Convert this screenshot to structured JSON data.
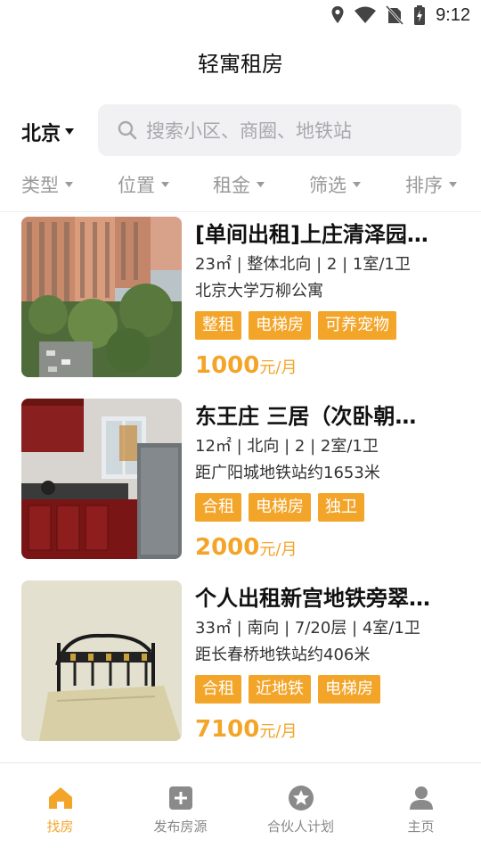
{
  "status": {
    "time": "9:12"
  },
  "app": {
    "title": "轻寓租房"
  },
  "city": {
    "name": "北京"
  },
  "search": {
    "placeholder": "搜索小区、商圈、地铁站"
  },
  "filters": [
    {
      "label": "类型"
    },
    {
      "label": "位置"
    },
    {
      "label": "租金"
    },
    {
      "label": "筛选"
    },
    {
      "label": "排序"
    }
  ],
  "listings": [
    {
      "title": "[单间出租]上庄清泽园…",
      "meta": "23㎡ | 整体北向 | 2 | 1室/1卫",
      "location": "北京大学万柳公寓",
      "tags": [
        "整租",
        "电梯房",
        "可养宠物"
      ],
      "price": "1000",
      "price_unit": "元/月"
    },
    {
      "title": "东王庄 三居（次卧朝…",
      "meta": "12㎡ | 北向 | 2 | 2室/1卫",
      "location": "距广阳城地铁站约1653米",
      "tags": [
        "合租",
        "电梯房",
        "独卫"
      ],
      "price": "2000",
      "price_unit": "元/月"
    },
    {
      "title": "个人出租新宫地铁旁翠…",
      "meta": "33㎡ | 南向 | 7/20层 | 4室/1卫",
      "location": "距长春桥地铁站约406米",
      "tags": [
        "合租",
        "近地铁",
        "电梯房"
      ],
      "price": "7100",
      "price_unit": "元/月"
    }
  ],
  "tabbar": [
    {
      "label": "找房",
      "icon": "home-icon",
      "active": true
    },
    {
      "label": "发布房源",
      "icon": "plus-square-icon",
      "active": false
    },
    {
      "label": "合伙人计划",
      "icon": "star-circle-icon",
      "active": false
    },
    {
      "label": "主页",
      "icon": "person-icon",
      "active": false
    }
  ],
  "colors": {
    "accent": "#f3a52a",
    "muted": "#9a9a9a",
    "search_bg": "#f1f1f3"
  }
}
